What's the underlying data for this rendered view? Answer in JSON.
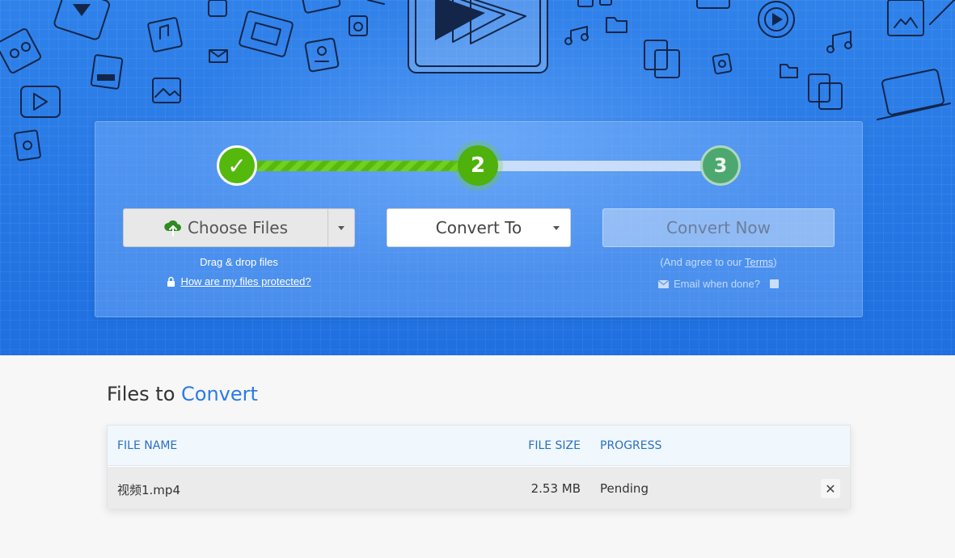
{
  "steps": [
    {
      "label": "✓",
      "state": "done"
    },
    {
      "label": "2",
      "state": "active"
    },
    {
      "label": "3",
      "state": "pending"
    }
  ],
  "choose_files": {
    "label": "Choose Files",
    "icon": "cloud-upload-icon"
  },
  "drag_drop": "Drag & drop files",
  "protection_link": "How are my files protected?",
  "convert_to": {
    "label": "Convert To"
  },
  "convert_now": {
    "label": "Convert Now"
  },
  "agree": {
    "prefix": "(And agree to our ",
    "terms": "Terms",
    "suffix": ")"
  },
  "email_when_done": "Email when done?",
  "files_heading": {
    "part1": "Files to ",
    "accent": "Convert"
  },
  "table": {
    "headers": [
      "FILE NAME",
      "FILE SIZE",
      "PROGRESS"
    ],
    "rows": [
      {
        "name": "视频1.mp4",
        "size": "2.53 MB",
        "progress": "Pending"
      }
    ]
  },
  "colors": {
    "accent": "#2b7be6",
    "success": "#55b80d",
    "header_text": "#2a6fc4"
  }
}
